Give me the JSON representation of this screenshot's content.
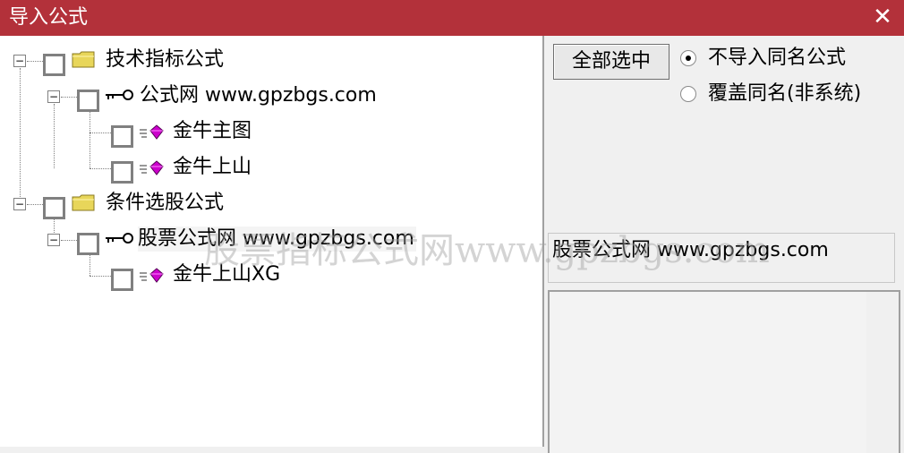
{
  "window": {
    "title": "导入公式",
    "close_glyph": "✕"
  },
  "tree": {
    "nodes": [
      {
        "label": "技术指标公式",
        "icon": "folder-icon",
        "expander": "−"
      },
      {
        "label": "公式网 www.gpzbgs.com",
        "icon": "key-icon",
        "expander": "−"
      },
      {
        "label": "金牛主图",
        "icon": "formula-gem-icon"
      },
      {
        "label": "金牛上山",
        "icon": "formula-gem-icon"
      },
      {
        "label": "条件选股公式",
        "icon": "folder-icon",
        "expander": "−"
      },
      {
        "label": "股票公式网 www.gpzbgs.com",
        "icon": "key-icon",
        "expander": "−"
      },
      {
        "label": "金牛上山XG",
        "icon": "formula-gem-icon"
      }
    ]
  },
  "watermark": "股票指标公式网www.gpzbgs.com",
  "controls": {
    "select_all_label": "全部选中",
    "options": [
      {
        "label": "不导入同名公式",
        "selected": true
      },
      {
        "label": "覆盖同名(非系统)",
        "selected": false
      }
    ]
  },
  "info": {
    "text": "股票公式网 www.gpzbgs.com"
  },
  "colors": {
    "titlebar": "#b3313a",
    "folder": "#e8d65a",
    "gem": "#cc00cc"
  }
}
